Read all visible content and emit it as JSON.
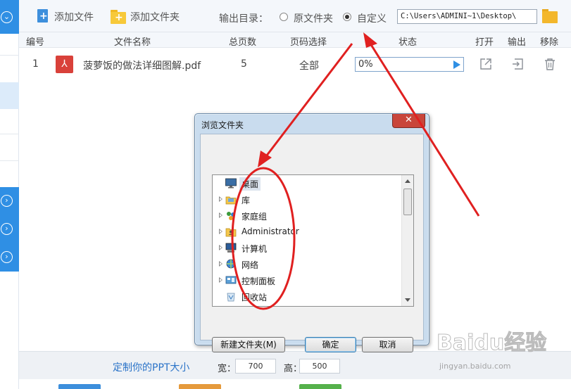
{
  "toolbar": {
    "add_file_label": "添加文件",
    "add_folder_label": "添加文件夹",
    "output_dir_label": "输出目录：",
    "radio_original_label": "原文件夹",
    "radio_custom_label": "自定义",
    "selected_output": "custom",
    "output_path": "C:\\Users\\ADMINI~1\\Desktop\\"
  },
  "table": {
    "columns": [
      "编号",
      "文件名称",
      "总页数",
      "页码选择",
      "状态",
      "打开",
      "输出",
      "移除"
    ],
    "rows": [
      {
        "index": "1",
        "filename": "菠萝饭的做法详细图解.pdf",
        "total_pages": "5",
        "page_selection": "全部",
        "status_percent": "0%",
        "progress": 0
      }
    ]
  },
  "bottom": {
    "custom_size_label": "定制你的PPT大小",
    "width_label": "宽：",
    "width_value": "700",
    "height_label": "高：",
    "height_value": "500"
  },
  "dialog": {
    "title": "浏览文件夹",
    "close_symbol": "✕",
    "tree_items": [
      {
        "label": "桌面",
        "icon": "desktop-icon",
        "selected": true,
        "expandable": false
      },
      {
        "label": "库",
        "icon": "library-icon",
        "selected": false,
        "expandable": true
      },
      {
        "label": "家庭组",
        "icon": "homegroup-icon",
        "selected": false,
        "expandable": true
      },
      {
        "label": "Administrator",
        "icon": "user-folder-icon",
        "selected": false,
        "expandable": true
      },
      {
        "label": "计算机",
        "icon": "computer-icon",
        "selected": false,
        "expandable": true
      },
      {
        "label": "网络",
        "icon": "network-icon",
        "selected": false,
        "expandable": true
      },
      {
        "label": "控制面板",
        "icon": "control-panel-icon",
        "selected": false,
        "expandable": true
      },
      {
        "label": "回收站",
        "icon": "recycle-bin-icon",
        "selected": false,
        "expandable": false
      }
    ],
    "new_folder_label": "新建文件夹(M)",
    "ok_label": "确定",
    "cancel_label": "取消"
  },
  "watermark": {
    "brand": "Baidu经验",
    "url": "jingyan.baidu.com"
  },
  "colors": {
    "accent_blue": "#2f8fe4",
    "annotation_red": "#e02020",
    "pdf_red": "#d9413a"
  }
}
